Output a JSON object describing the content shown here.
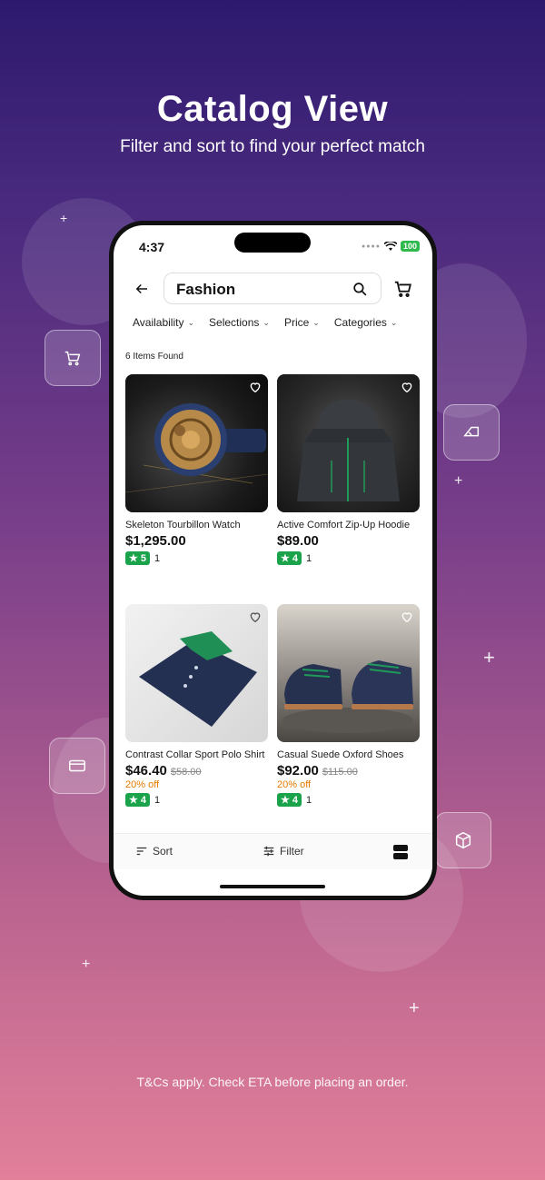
{
  "promo": {
    "headline": "Catalog View",
    "subhead": "Filter and sort to find your perfect match",
    "footer_note": "T&Cs apply. Check ETA before placing an order."
  },
  "status_bar": {
    "time": "4:37",
    "battery": "100"
  },
  "search": {
    "value": "Fashion"
  },
  "filters": [
    {
      "label": "Availability"
    },
    {
      "label": "Selections"
    },
    {
      "label": "Price"
    },
    {
      "label": "Categories"
    }
  ],
  "results": {
    "count_text": "6 Items Found"
  },
  "products": [
    {
      "name": "Skeleton Tourbillon Watch",
      "price": "$1,295.00",
      "original_price": "",
      "discount": "",
      "rating": "5",
      "rating_count": "1"
    },
    {
      "name": "Active Comfort Zip-Up Hoodie",
      "price": "$89.00",
      "original_price": "",
      "discount": "",
      "rating": "4",
      "rating_count": "1"
    },
    {
      "name": "Contrast Collar Sport Polo Shirt",
      "price": "$46.40",
      "original_price": "$58.00",
      "discount": "20% off",
      "rating": "4",
      "rating_count": "1"
    },
    {
      "name": "Casual Suede Oxford Shoes",
      "price": "$92.00",
      "original_price": "$115.00",
      "discount": "20% off",
      "rating": "4",
      "rating_count": "1"
    }
  ],
  "bottom_bar": {
    "sort_label": "Sort",
    "filter_label": "Filter"
  },
  "colors": {
    "rating_green": "#1aa34a",
    "discount_orange": "#e67a00",
    "battery_green": "#2fb84b"
  }
}
